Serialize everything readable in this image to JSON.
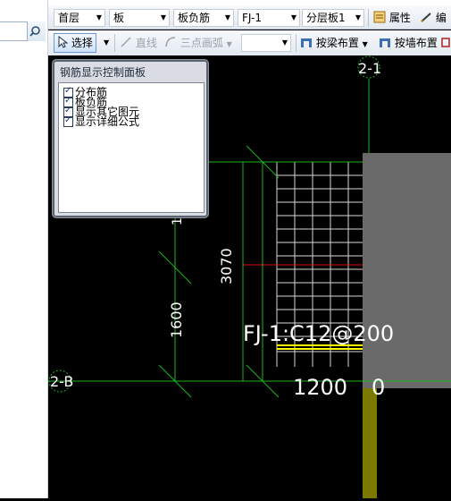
{
  "toolbar1": {
    "floor": "首层",
    "element_type": "板",
    "rebar_type": "板负筋",
    "rebar_name": "FJ-1",
    "layer": "分层板1",
    "properties_label": "属性",
    "edit_label": "编"
  },
  "toolbar2": {
    "select_label": "选择",
    "line_label": "直线",
    "arc_label": "三点画弧",
    "blank_combo": "",
    "beam_layout_label": "按梁布置",
    "wall_layout_label": "按墙布置"
  },
  "panel": {
    "title": "钢筋显示控制面板",
    "options": [
      {
        "label": "分布筋",
        "checked": true
      },
      {
        "label": "板负筋",
        "checked": true
      },
      {
        "label": "显示其它图元",
        "checked": true
      },
      {
        "label": "显示详细公式",
        "checked": true
      }
    ]
  },
  "drawing": {
    "axis_top": "2-1",
    "axis_left": "2-B",
    "dim_3070": "3070",
    "dim_1600": "1600",
    "dim_1200": "1200",
    "dim_0": "0",
    "rebar_label": "FJ-1:C12@200",
    "partial_dim": "1"
  },
  "colors": {
    "canvas_bg": "#000000",
    "axis_green": "#1fb51f",
    "grid_white": "#d8d8d8",
    "wall_gray": "#6a6a6a",
    "column_olive": "#7b7a00",
    "rebar_yellow": "#ffff00",
    "highlight_red": "#d01010"
  }
}
